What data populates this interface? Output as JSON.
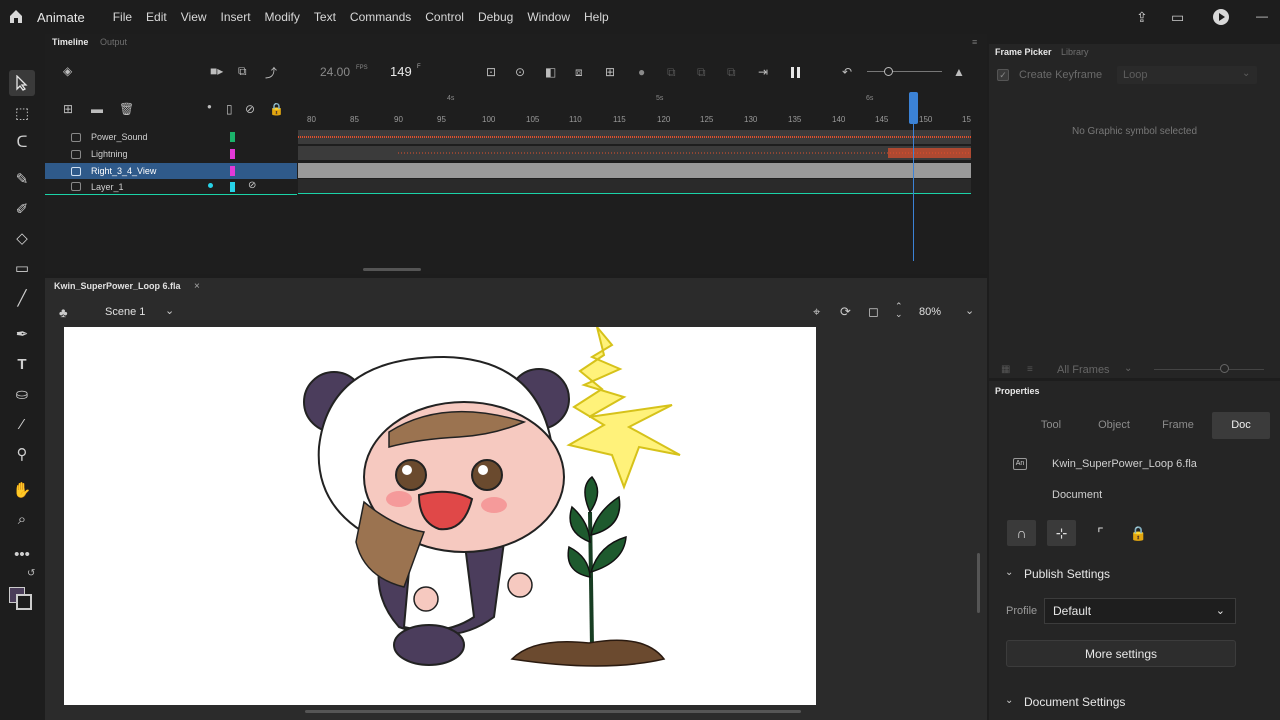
{
  "app": {
    "name": "Animate"
  },
  "menu": [
    "File",
    "Edit",
    "View",
    "Insert",
    "Modify",
    "Text",
    "Commands",
    "Control",
    "Debug",
    "Window",
    "Help"
  ],
  "timeline": {
    "tabs": {
      "active": "Timeline",
      "inactive": "Output"
    },
    "fps": "24.00",
    "fps_unit": "FPS",
    "current_frame": "149",
    "frame_unit": "F",
    "frame_numbers": [
      "80",
      "85",
      "90",
      "95",
      "100",
      "105",
      "110",
      "115",
      "120",
      "125",
      "130",
      "135",
      "140",
      "145",
      "150",
      "15"
    ],
    "seconds": [
      "4s",
      "5s",
      "6s"
    ],
    "layers": [
      {
        "name": "Power_Sound",
        "color": "#1bb36b"
      },
      {
        "name": "Lightning",
        "color": "#e339d8"
      },
      {
        "name": "Right_3_4_View",
        "color": "#e339d8"
      },
      {
        "name": "Layer_1",
        "color": "#27d3e8"
      }
    ]
  },
  "document": {
    "tab_title": "Kwin_SuperPower_Loop 6.fla",
    "scene": "Scene 1",
    "zoom": "80%"
  },
  "frame_picker": {
    "tabs": {
      "active": "Frame Picker",
      "inactive": "Library"
    },
    "create_keyframe": "Create Keyframe",
    "loop": "Loop",
    "message": "No Graphic symbol selected",
    "all_frames": "All Frames"
  },
  "properties": {
    "title": "Properties",
    "tabs": [
      "Tool",
      "Object",
      "Frame",
      "Doc"
    ],
    "active_tab": "Doc",
    "doc_name": "Kwin_SuperPower_Loop 6.fla",
    "doc_type": "Document",
    "publish_settings": "Publish Settings",
    "profile_label": "Profile",
    "profile_value": "Default",
    "more_settings": "More settings",
    "document_settings": "Document Settings"
  },
  "colors": {
    "accent": "#2f5a8a",
    "playhead": "#3b82d6",
    "selection": "#1bd3a8",
    "sound_wave": "#e0502d"
  }
}
